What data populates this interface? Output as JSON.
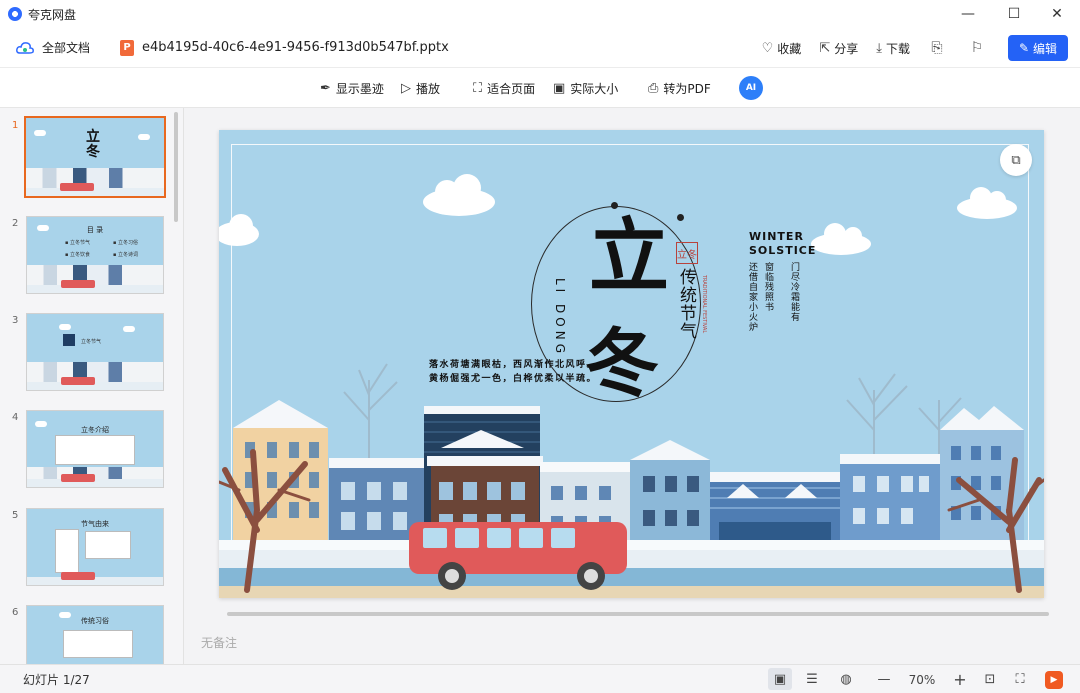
{
  "window": {
    "app_title": "夸克网盘",
    "controls": [
      "—",
      "☐",
      "✕"
    ]
  },
  "filebar": {
    "all_docs": "全部文档",
    "file_badge": "P",
    "filename": "e4b4195d-40c6-4e91-9456-f913d0b547bf.pptx",
    "favorite": "收藏",
    "share": "分享",
    "download": "下载",
    "edit": "编辑"
  },
  "toolbar": {
    "show_ink": "显示墨迹",
    "play": "播放",
    "fit_page": "适合页面",
    "actual_size": "实际大小",
    "to_pdf": "转为PDF",
    "ai": "AI"
  },
  "thumbnails": [
    {
      "num": "1",
      "active": true
    },
    {
      "num": "2",
      "active": false
    },
    {
      "num": "3",
      "active": false
    },
    {
      "num": "4",
      "active": false
    },
    {
      "num": "5",
      "active": false
    },
    {
      "num": "6",
      "active": false
    }
  ],
  "slide": {
    "char1": "立",
    "char2": "冬",
    "seal": "立冬",
    "traditional": "传统节气",
    "traditional_en": "TRADITIONAL FESTIVAL",
    "lidong": "LI DONG",
    "poem1": "落水荷塘满眼枯，西风渐作北风呼。",
    "poem2": "黄杨倔强尤一色，白桦优柔以半疏。",
    "winter1": "WINTER",
    "winter2": "SOLSTICE",
    "vpoem": [
      "门尽冷霜能有",
      "寂寥枯槁",
      "窗临残照书",
      "拟约三九吟梅雪",
      "还借自家小火炉"
    ]
  },
  "notes": "无备注",
  "statusbar": {
    "slide_count": "幻灯片 1/27",
    "zoom": "70%"
  },
  "colors": {
    "accent": "#2462f6",
    "active_thumb": "#e8681f",
    "slide_bg": "#a9d3ea",
    "bus": "#e05a5a"
  }
}
